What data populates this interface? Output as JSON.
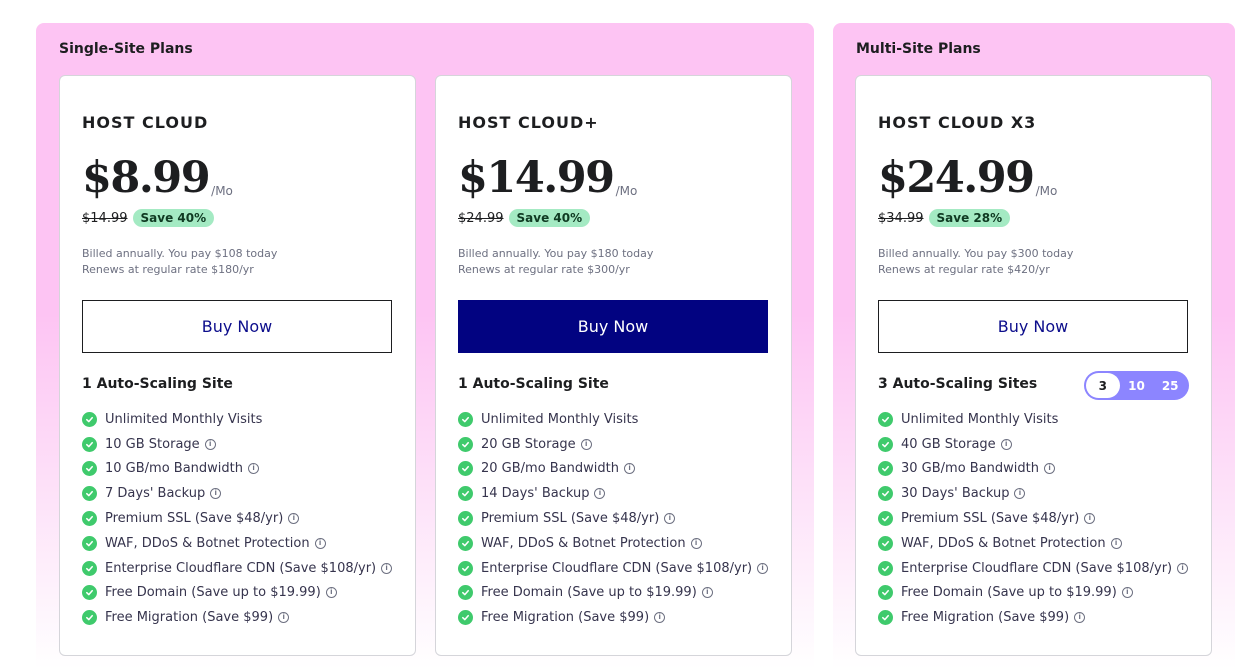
{
  "groups": {
    "single": {
      "title": "Single-Site Plans"
    },
    "multi": {
      "title": "Multi-Site Plans"
    }
  },
  "plans": [
    {
      "name": "HOST CLOUD",
      "price": "$8.99",
      "per": "/Mo",
      "old_price": "$14.99",
      "save": "Save 40%",
      "billed": "Billed annually. You pay $108 today",
      "renews": "Renews at regular rate $180/yr",
      "button": "Buy Now",
      "sites": "1 Auto-Scaling Site",
      "features": [
        {
          "text": "Unlimited Monthly Visits",
          "info": false
        },
        {
          "text": "10 GB Storage",
          "info": true
        },
        {
          "text": "10 GB/mo Bandwidth",
          "info": true
        },
        {
          "text": "7 Days' Backup",
          "info": true
        },
        {
          "text": "Premium SSL (Save $48/yr)",
          "info": true
        },
        {
          "text": "WAF, DDoS & Botnet Protection",
          "info": true
        },
        {
          "text": "Enterprise Cloudflare CDN (Save $108/yr)",
          "info": true
        },
        {
          "text": "Free Domain (Save up to $19.99)",
          "info": true
        },
        {
          "text": "Free Migration (Save $99)",
          "info": true
        }
      ]
    },
    {
      "name": "HOST CLOUD+",
      "price": "$14.99",
      "per": "/Mo",
      "old_price": "$24.99",
      "save": "Save 40%",
      "billed": "Billed annually. You pay $180 today",
      "renews": "Renews at regular rate $300/yr",
      "button": "Buy Now",
      "sites": "1 Auto-Scaling Site",
      "features": [
        {
          "text": "Unlimited Monthly Visits",
          "info": false
        },
        {
          "text": "20 GB Storage",
          "info": true
        },
        {
          "text": "20 GB/mo Bandwidth",
          "info": true
        },
        {
          "text": "14 Days' Backup",
          "info": true
        },
        {
          "text": "Premium SSL (Save $48/yr)",
          "info": true
        },
        {
          "text": "WAF, DDoS & Botnet Protection",
          "info": true
        },
        {
          "text": "Enterprise Cloudflare CDN (Save $108/yr)",
          "info": true
        },
        {
          "text": "Free Domain (Save up to $19.99)",
          "info": true
        },
        {
          "text": "Free Migration (Save $99)",
          "info": true
        }
      ]
    },
    {
      "name": "HOST CLOUD X3",
      "price": "$24.99",
      "per": "/Mo",
      "old_price": "$34.99",
      "save": "Save 28%",
      "billed": "Billed annually. You pay $300 today",
      "renews": "Renews at regular rate $420/yr",
      "button": "Buy Now",
      "sites": "3 Auto-Scaling Sites",
      "site_options": [
        "3",
        "10",
        "25"
      ],
      "features": [
        {
          "text": "Unlimited Monthly Visits",
          "info": false
        },
        {
          "text": "40 GB Storage",
          "info": true
        },
        {
          "text": "30 GB/mo Bandwidth",
          "info": true
        },
        {
          "text": "30 Days' Backup",
          "info": true
        },
        {
          "text": "Premium SSL (Save $48/yr)",
          "info": true
        },
        {
          "text": "WAF, DDoS & Botnet Protection",
          "info": true
        },
        {
          "text": "Enterprise Cloudflare CDN (Save $108/yr)",
          "info": true
        },
        {
          "text": "Free Domain (Save up to $19.99)",
          "info": true
        },
        {
          "text": "Free Migration (Save $99)",
          "info": true
        }
      ]
    }
  ],
  "icons": {
    "check": "check-circle-icon",
    "info": "info-icon"
  },
  "colors": {
    "accent": "#020381",
    "group_bg": "#fdc4f3",
    "save_badge": "#a4eac3",
    "check": "#3fca6c",
    "toggle": "#8c85ff"
  }
}
